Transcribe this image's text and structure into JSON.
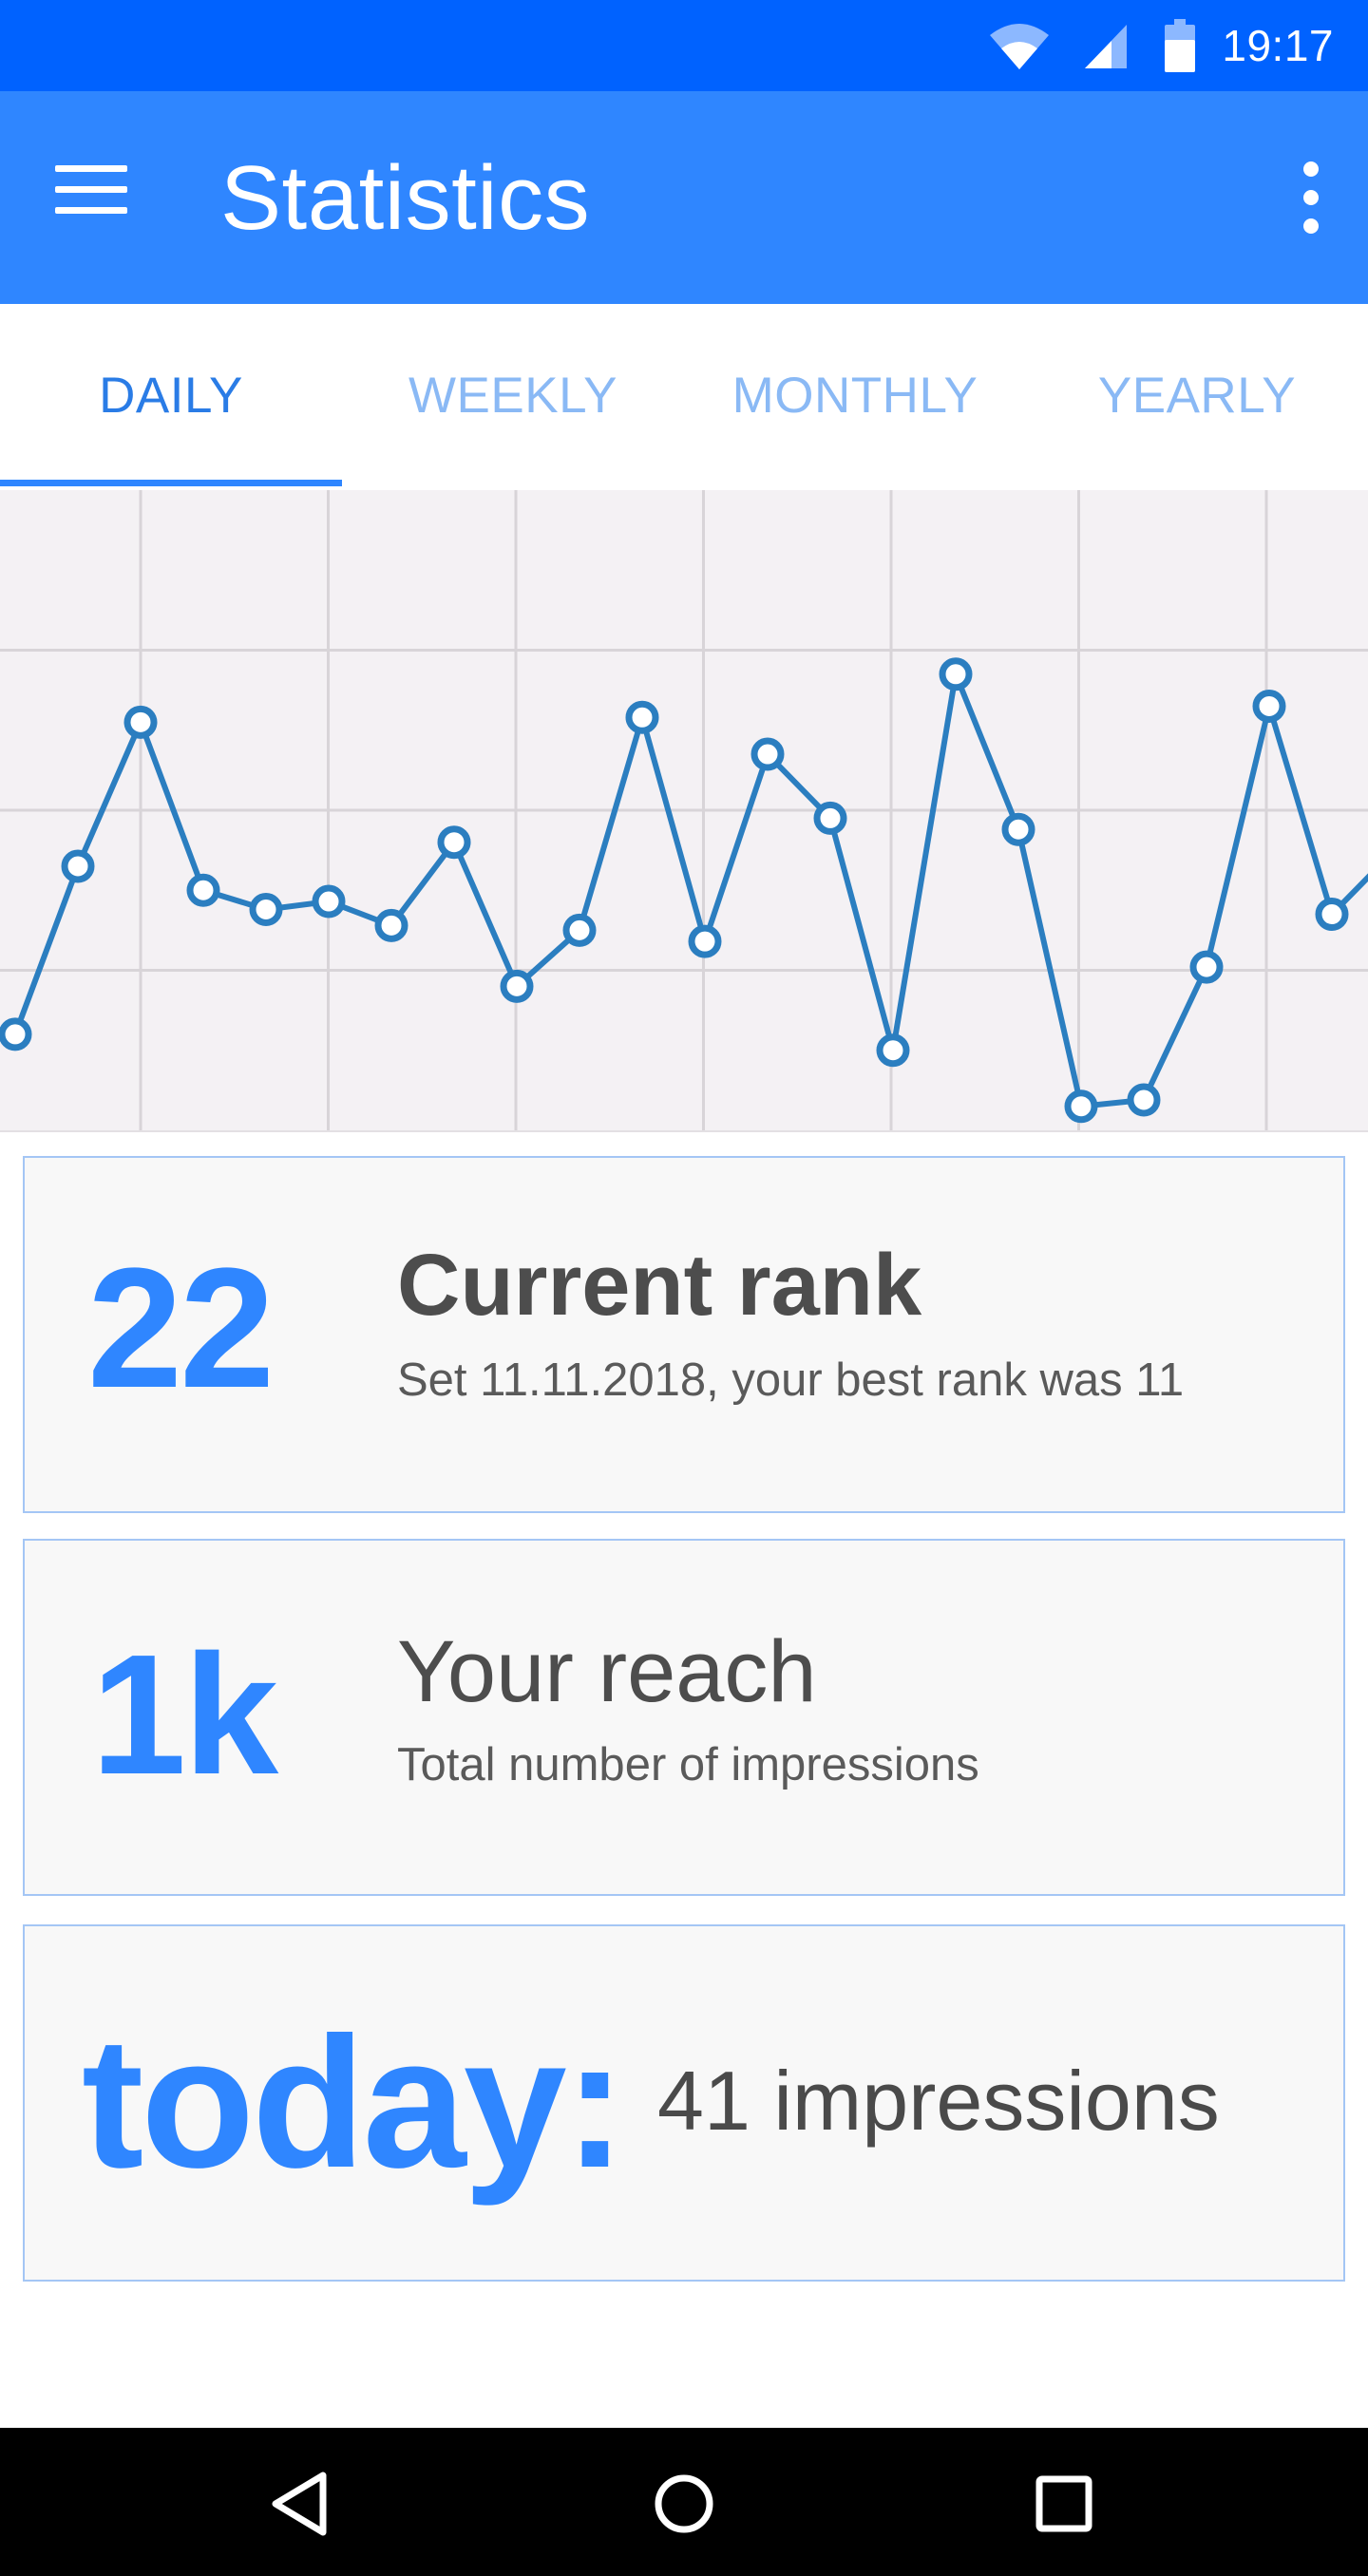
{
  "status_bar": {
    "time": "19:17",
    "icons": [
      "wifi-icon",
      "cellular-signal-icon",
      "battery-icon"
    ],
    "background_color": "#0062ff"
  },
  "app_bar": {
    "title": "Statistics",
    "menu_icon": "hamburger-menu-icon",
    "overflow_icon": "more-vert-icon",
    "background_color": "#2f86ff"
  },
  "tabs": [
    {
      "label": "DAILY",
      "active": true
    },
    {
      "label": "WEEKLY",
      "active": false
    },
    {
      "label": "MONTHLY",
      "active": false
    },
    {
      "label": "YEARLY",
      "active": false
    }
  ],
  "chart_data": {
    "type": "line",
    "title": "",
    "xlabel": "",
    "ylabel": "",
    "grid": true,
    "ylim": [
      0,
      4
    ],
    "series": [
      {
        "color": "#2b7ec0",
        "values": [
          0.6,
          1.65,
          2.55,
          1.5,
          1.38,
          1.43,
          1.28,
          1.8,
          0.9,
          1.25,
          2.58,
          1.18,
          2.35,
          1.95,
          0.5,
          2.85,
          1.88,
          0.15,
          0.19,
          1.02,
          2.65,
          1.35,
          1.75
        ]
      }
    ]
  },
  "cards": [
    {
      "value": "22",
      "title": "Current rank",
      "subtitle": "Set 11.11.2018, your best rank was 11"
    },
    {
      "value": "1k",
      "title": "Your reach",
      "subtitle": "Total number of impressions"
    },
    {
      "value": "today:",
      "text": "41 impressions"
    }
  ],
  "nav_bar": {
    "buttons": [
      "back-icon",
      "home-icon",
      "recents-icon"
    ]
  },
  "accent_color": "#2f86ff"
}
